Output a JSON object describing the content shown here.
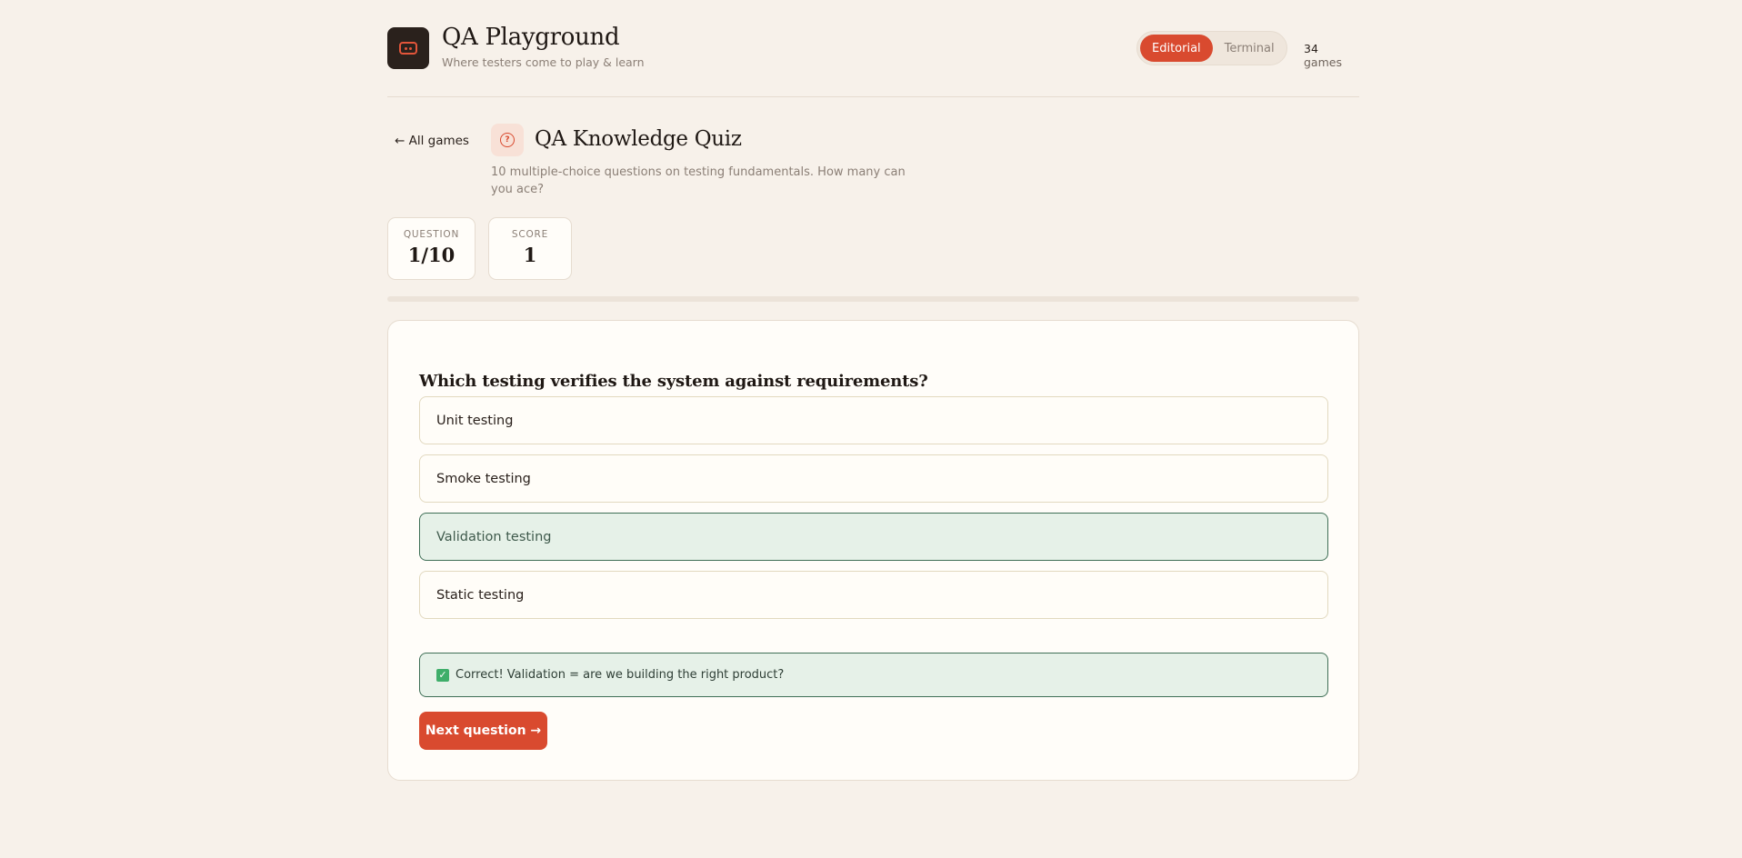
{
  "header": {
    "title": "QA Playground",
    "subtitle": "Where testers come to play & learn",
    "modes": [
      "Editorial",
      "Terminal"
    ],
    "active_mode": "Editorial",
    "game_count": "34",
    "game_count_label": "games"
  },
  "nav": {
    "back_label": "← All games"
  },
  "quiz": {
    "title": "QA Knowledge Quiz",
    "description": "10 multiple-choice questions on testing fundamentals. How many can you ace?"
  },
  "stats": {
    "question_label": "QUESTION",
    "question_value": "1/10",
    "score_label": "SCORE",
    "score_value": "1"
  },
  "progress": {
    "fraction": 0.0
  },
  "card": {
    "question": "Which testing verifies the system against requirements?",
    "options": [
      "Unit testing",
      "Smoke testing",
      "Validation testing",
      "Static testing"
    ],
    "correct_index": 2,
    "feedback": "Correct! Validation = are we building the right product?",
    "next_label": "Next question →"
  },
  "colors": {
    "accent": "#d94a2f",
    "success_bg": "#e6f1e8",
    "success_border": "#3f6f56",
    "background": "#f7f1ea"
  }
}
